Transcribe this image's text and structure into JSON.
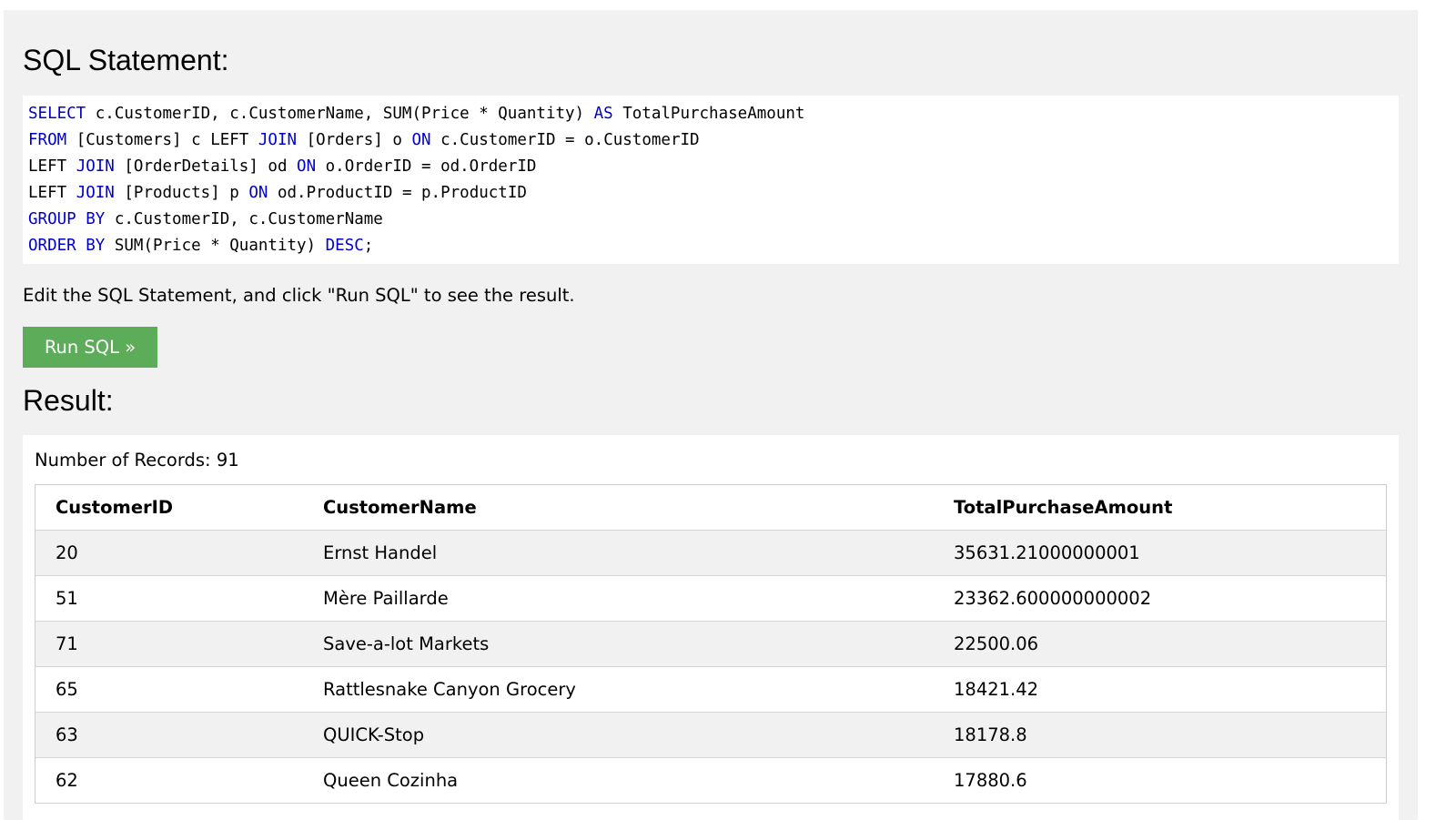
{
  "sql_section": {
    "title": "SQL Statement:",
    "lines": [
      [
        {
          "t": "SELECT",
          "kw": true
        },
        {
          "t": " c.CustomerID, c.CustomerName, SUM(Price * Quantity) ",
          "kw": false
        },
        {
          "t": "AS",
          "kw": true
        },
        {
          "t": " TotalPurchaseAmount",
          "kw": false
        }
      ],
      [
        {
          "t": "FROM",
          "kw": true
        },
        {
          "t": " [Customers] c LEFT ",
          "kw": false
        },
        {
          "t": "JOIN",
          "kw": true
        },
        {
          "t": " [Orders] o ",
          "kw": false
        },
        {
          "t": "ON",
          "kw": true
        },
        {
          "t": " c.CustomerID = o.CustomerID",
          "kw": false
        }
      ],
      [
        {
          "t": "LEFT ",
          "kw": false
        },
        {
          "t": "JOIN",
          "kw": true
        },
        {
          "t": " [OrderDetails] od ",
          "kw": false
        },
        {
          "t": "ON",
          "kw": true
        },
        {
          "t": " o.OrderID = od.OrderID",
          "kw": false
        }
      ],
      [
        {
          "t": "LEFT ",
          "kw": false
        },
        {
          "t": "JOIN",
          "kw": true
        },
        {
          "t": " [Products] p ",
          "kw": false
        },
        {
          "t": "ON",
          "kw": true
        },
        {
          "t": " od.ProductID = p.ProductID",
          "kw": false
        }
      ],
      [
        {
          "t": "GROUP BY",
          "kw": true
        },
        {
          "t": " c.CustomerID, c.CustomerName",
          "kw": false
        }
      ],
      [
        {
          "t": "ORDER BY",
          "kw": true
        },
        {
          "t": " SUM(Price * Quantity) ",
          "kw": false
        },
        {
          "t": "DESC",
          "kw": true
        },
        {
          "t": ";",
          "kw": false
        }
      ]
    ],
    "instructions": "Edit the SQL Statement, and click \"Run SQL\" to see the result.",
    "run_button_label": "Run SQL »"
  },
  "result_section": {
    "title": "Result:",
    "records_label": "Number of Records: 91",
    "columns": [
      "CustomerID",
      "CustomerName",
      "TotalPurchaseAmount"
    ],
    "rows": [
      [
        "20",
        "Ernst Handel",
        "35631.21000000001"
      ],
      [
        "51",
        "Mère Paillarde",
        "23362.600000000002"
      ],
      [
        "71",
        "Save-a-lot Markets",
        "22500.06"
      ],
      [
        "65",
        "Rattlesnake Canyon Grocery",
        "18421.42"
      ],
      [
        "63",
        "QUICK-Stop",
        "18178.8"
      ],
      [
        "62",
        "Queen Cozinha",
        "17880.6"
      ]
    ]
  },
  "colors": {
    "keyword": "#0000cd",
    "button_bg": "#5cac59",
    "panel_bg": "#f1f1f1"
  }
}
